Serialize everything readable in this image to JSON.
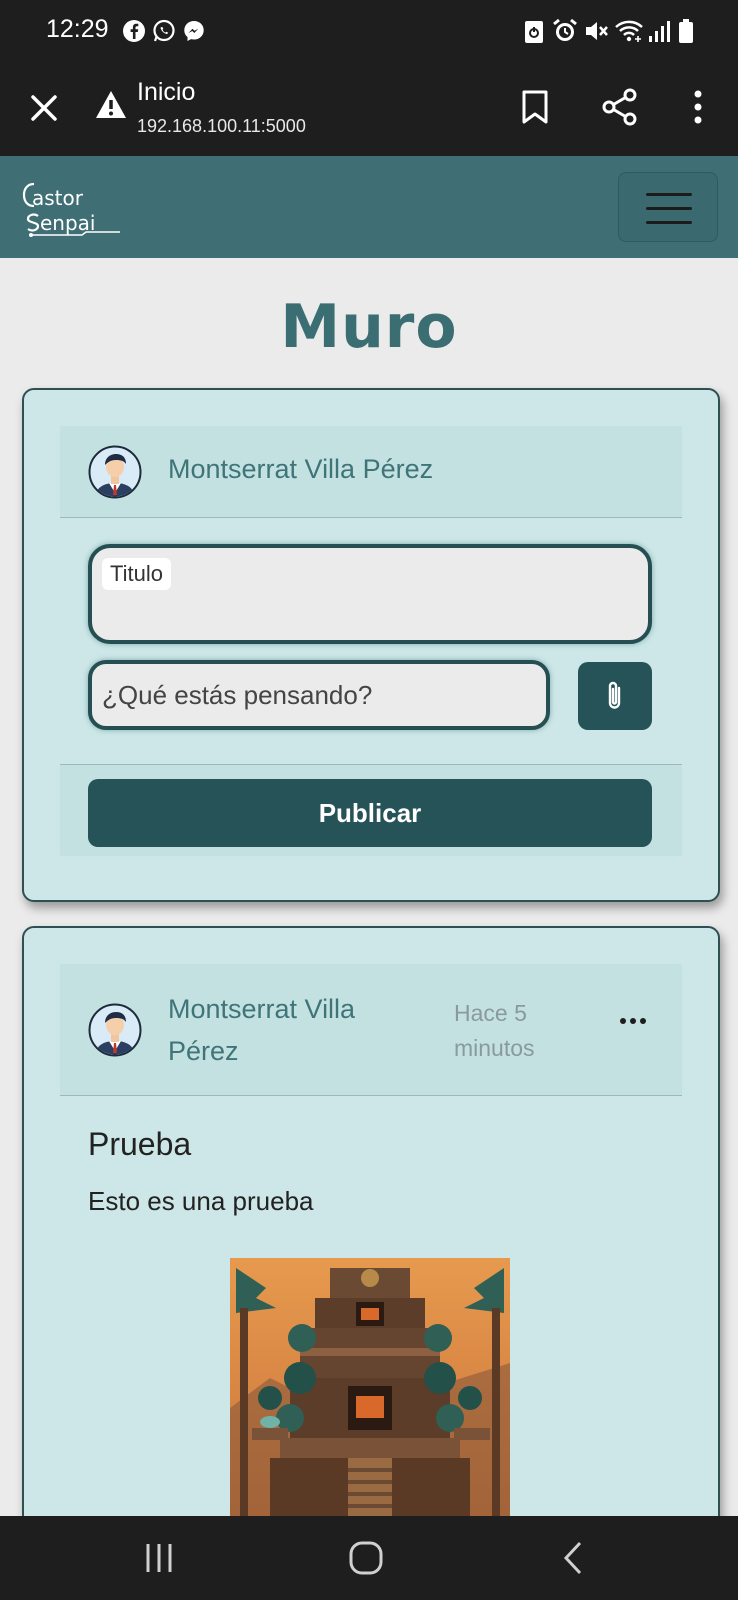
{
  "status_bar": {
    "time": "12:29",
    "app_icons": [
      "facebook-icon",
      "whatsapp-icon",
      "messenger-icon"
    ],
    "right_icons": [
      "data-saver-icon",
      "alarm-icon",
      "mute-icon",
      "wifi-icon",
      "signal-icon",
      "battery-icon"
    ]
  },
  "browser": {
    "page_title": "Inicio",
    "url": "192.168.100.11:5000",
    "icons": [
      "close-icon",
      "warning-icon",
      "bookmark-icon",
      "share-icon",
      "more-vert-icon"
    ]
  },
  "navbar": {
    "logo_text": "Castor Senpai",
    "menu_icon": "hamburger-icon"
  },
  "page": {
    "title": "Muro"
  },
  "composer": {
    "author": "Montserrat Villa Pérez",
    "title_label": "Titulo",
    "body_placeholder": "¿Qué estás pensando?",
    "attach_icon": "paperclip-icon",
    "publish_label": "Publicar"
  },
  "post": {
    "author": "Montserrat Villa Pérez",
    "time": "Hace 5 minutos",
    "menu_icon": "more-horiz-icon",
    "title": "Prueba",
    "body": "Esto es una prueba"
  },
  "android_nav": {
    "icons": [
      "recents-icon",
      "home-icon",
      "back-icon"
    ]
  },
  "colors": {
    "navbar": "#3f6f74",
    "accent_dark": "#265357",
    "card_bg": "#cde7e8",
    "title_color": "#3b6e73"
  }
}
